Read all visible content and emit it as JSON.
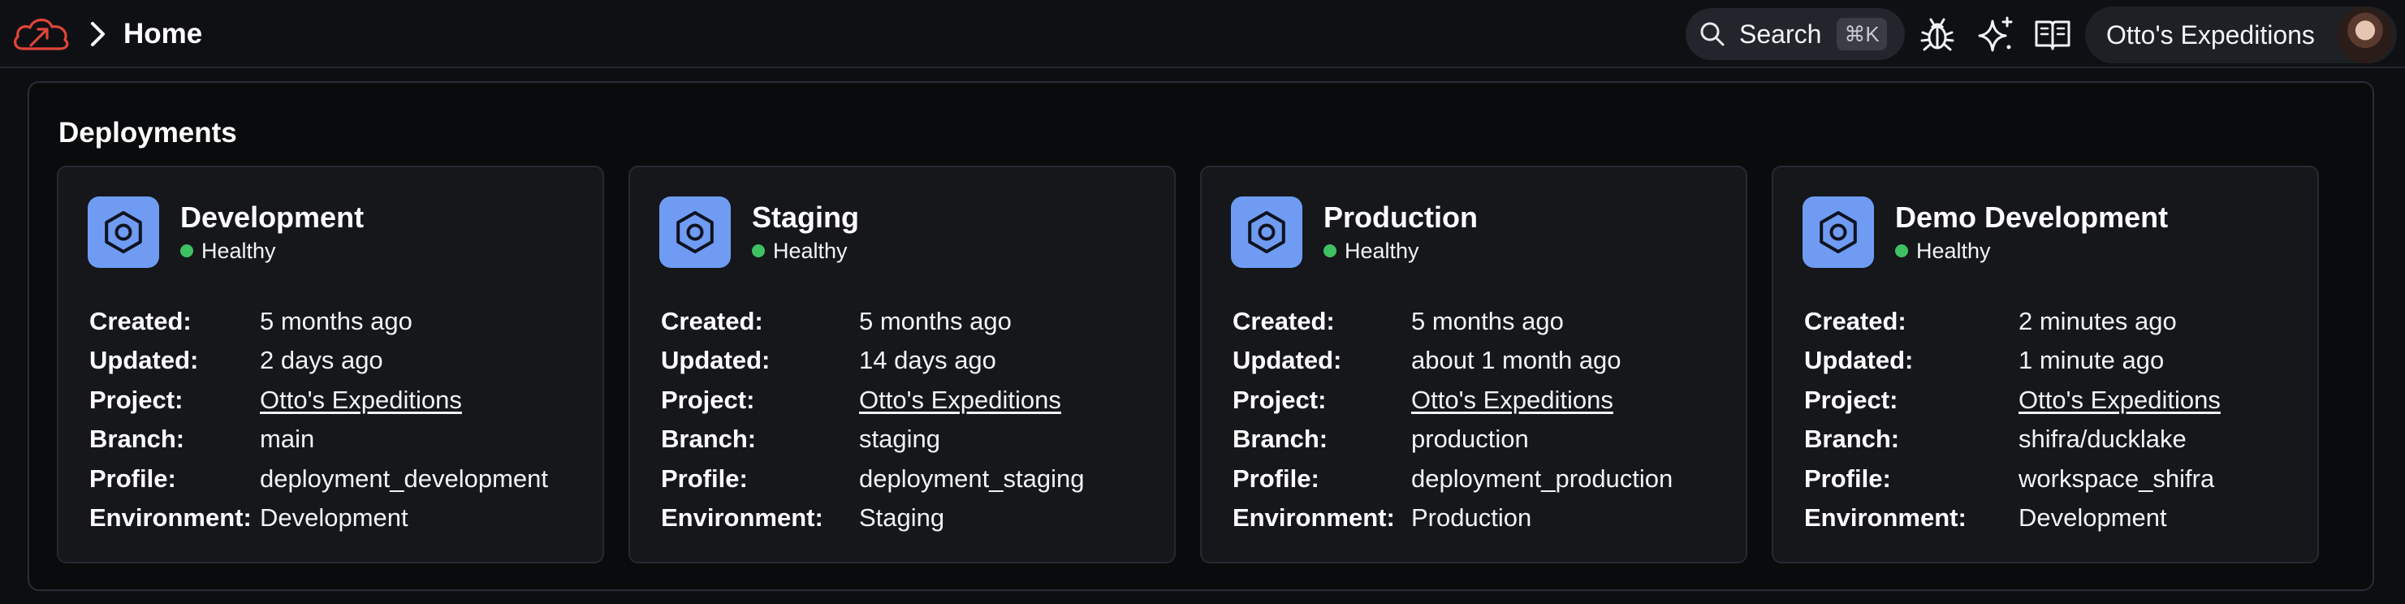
{
  "header": {
    "breadcrumb_home": "Home",
    "search_label": "Search",
    "search_shortcut": "⌘K",
    "org_name": "Otto's Expeditions"
  },
  "icons": {
    "logo": "cloud-logo-icon",
    "breadcrumb": "chevron-right-icon",
    "search": "search-icon",
    "bug": "bug-icon",
    "ai": "sparkles-icon",
    "docs": "book-icon",
    "deployment": "hexagon-icon"
  },
  "colors": {
    "accent_blue": "#6f9cf2",
    "healthy_green": "#3fc163",
    "logo_red": "#e0453a"
  },
  "panel": {
    "title": "Deployments",
    "labels": {
      "created": "Created:",
      "updated": "Updated:",
      "project": "Project:",
      "branch": "Branch:",
      "profile": "Profile:",
      "environment": "Environment:"
    }
  },
  "deployments": [
    {
      "name": "Development",
      "status": "Healthy",
      "created": "5 months ago",
      "updated": "2 days ago",
      "project": "Otto's Expeditions",
      "branch": "main",
      "profile": "deployment_development",
      "environment": "Development"
    },
    {
      "name": "Staging",
      "status": "Healthy",
      "created": "5 months ago",
      "updated": "14 days ago",
      "project": "Otto's Expeditions",
      "branch": "staging",
      "profile": "deployment_staging",
      "environment": "Staging"
    },
    {
      "name": "Production",
      "status": "Healthy",
      "created": "5 months ago",
      "updated": "about 1 month ago",
      "project": "Otto's Expeditions",
      "branch": "production",
      "profile": "deployment_production",
      "environment": "Production"
    },
    {
      "name": "Demo Development",
      "status": "Healthy",
      "created": "2 minutes ago",
      "updated": "1 minute ago",
      "project": "Otto's Expeditions",
      "branch": "shifra/ducklake",
      "profile": "workspace_shifra",
      "environment": "Development"
    }
  ]
}
